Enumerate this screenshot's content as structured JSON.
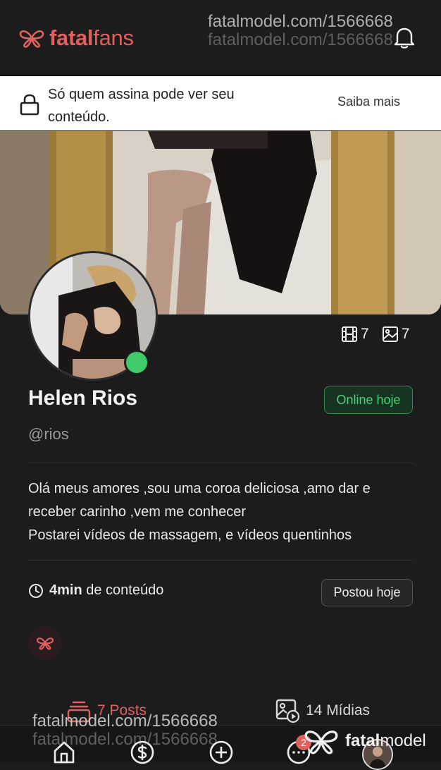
{
  "header": {
    "logo_text_a": "fatal",
    "logo_text_b": "fans",
    "watermark_1": "fatalmodel.com/1566668",
    "watermark_2": "fatalmodel.com/1566668"
  },
  "banner": {
    "message": "Só quem assina pode ver seu conteúdo.",
    "link": "Saiba mais"
  },
  "profile": {
    "name": "Helen Rios",
    "handle": "@rios",
    "status": "Online hoje",
    "videos_count": "7",
    "photos_count": "7",
    "bio_line_1": "Olá meus amores ,sou uma coroa deliciosa ,amo dar e",
    "bio_line_2": "receber carinho ,vem me conhecer",
    "bio_line_3": "Postarei vídeos de massagem, e vídeos quentinhos",
    "content_amount": "4min",
    "content_label": "de conteúdo",
    "posted": "Postou hoje"
  },
  "tabs": {
    "posts": "7 Posts",
    "media": "14 Mídias"
  },
  "bottom": {
    "badge": "2",
    "watermark_1": "fatalmodel.com/1566668",
    "watermark_2": "fatalmodel.com/1566668",
    "brand_a": "fatal",
    "brand_b": "model"
  },
  "colors": {
    "accent": "#e0605d",
    "online": "#46d672",
    "background": "#1c1c1c"
  }
}
